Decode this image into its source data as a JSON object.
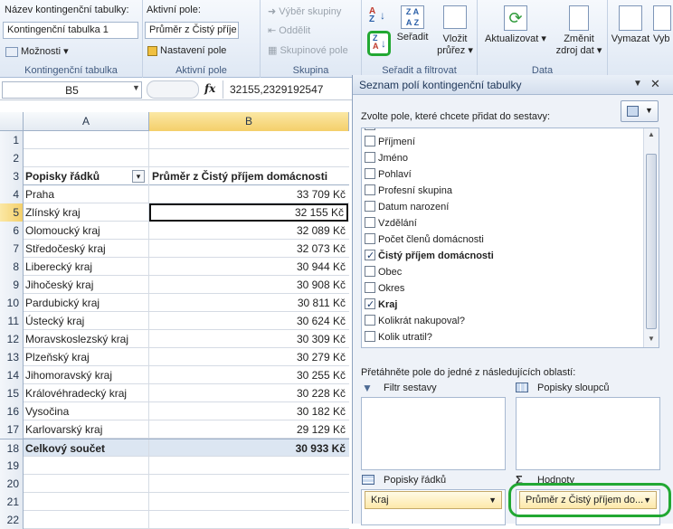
{
  "ribbon": {
    "pivot_name_label": "Název kontingenční tabulky:",
    "pivot_name_value": "Kontingenční tabulka 1",
    "options_label": "Možnosti",
    "group_pivot": "Kontingenční tabulka",
    "active_field_label": "Aktivní pole:",
    "active_field_value": "Průměr z Čistý příje",
    "field_settings_label": "Nastavení pole",
    "group_active_field": "Aktivní pole",
    "group_selection": "Výběr skupiny",
    "ungroup": "Oddělit",
    "group_field": "Skupinové pole",
    "group_group": "Skupina",
    "sort": "Seřadit",
    "group_sort_filter": "Seřadit a filtrovat",
    "insert_slicer_1": "Vložit",
    "insert_slicer_2": "průřez",
    "refresh": "Aktualizovat",
    "change_source_1": "Změnit",
    "change_source_2": "zdroj dat",
    "group_data": "Data",
    "clear": "Vymazat",
    "select": "Vyb"
  },
  "formula": {
    "cell_ref": "B5",
    "fx": "fx",
    "value": "32155,2329192547"
  },
  "grid": {
    "columns": [
      "A",
      "B"
    ],
    "rows": [
      {
        "n": "1",
        "a": "",
        "b": ""
      },
      {
        "n": "2",
        "a": "",
        "b": ""
      },
      {
        "n": "3",
        "a": "Popisky řádků",
        "b": "Průměr z Čistý příjem domácnosti"
      },
      {
        "n": "4",
        "a": "Praha",
        "b": "33 709 Kč"
      },
      {
        "n": "5",
        "a": "Zlínský kraj",
        "b": "32 155 Kč"
      },
      {
        "n": "6",
        "a": "Olomoucký kraj",
        "b": "32 089 Kč"
      },
      {
        "n": "7",
        "a": "Středočeský kraj",
        "b": "32 073 Kč"
      },
      {
        "n": "8",
        "a": "Liberecký kraj",
        "b": "30 944 Kč"
      },
      {
        "n": "9",
        "a": "Jihočeský kraj",
        "b": "30 908 Kč"
      },
      {
        "n": "10",
        "a": "Pardubický kraj",
        "b": "30 811 Kč"
      },
      {
        "n": "11",
        "a": "Ústecký kraj",
        "b": "30 624 Kč"
      },
      {
        "n": "12",
        "a": "Moravskoslezský kraj",
        "b": "30 309 Kč"
      },
      {
        "n": "13",
        "a": "Plzeňský kraj",
        "b": "30 279 Kč"
      },
      {
        "n": "14",
        "a": "Jihomoravský kraj",
        "b": "30 255 Kč"
      },
      {
        "n": "15",
        "a": "Královéhradecký kraj",
        "b": "30 228 Kč"
      },
      {
        "n": "16",
        "a": "Vysočina",
        "b": "30 182 Kč"
      },
      {
        "n": "17",
        "a": "Karlovarský kraj",
        "b": "29 129 Kč"
      },
      {
        "n": "18",
        "a": "Celkový součet",
        "b": "30 933 Kč"
      },
      {
        "n": "19",
        "a": "",
        "b": ""
      },
      {
        "n": "20",
        "a": "",
        "b": ""
      },
      {
        "n": "21",
        "a": "",
        "b": ""
      },
      {
        "n": "22",
        "a": "",
        "b": ""
      }
    ]
  },
  "pane": {
    "title": "Seznam polí kontingenční tabulky",
    "choose_label": "Zvolte pole, které chcete přidat do sestavy:",
    "fields": [
      {
        "label": "Příjmení",
        "checked": false,
        "bold": false
      },
      {
        "label": "Jméno",
        "checked": false,
        "bold": false
      },
      {
        "label": "Pohlaví",
        "checked": false,
        "bold": false
      },
      {
        "label": "Profesní skupina",
        "checked": false,
        "bold": false
      },
      {
        "label": "Datum narození",
        "checked": false,
        "bold": false
      },
      {
        "label": "Vzdělání",
        "checked": false,
        "bold": false
      },
      {
        "label": "Počet členů domácnosti",
        "checked": false,
        "bold": false
      },
      {
        "label": "Čistý příjem domácnosti",
        "checked": true,
        "bold": true
      },
      {
        "label": "Obec",
        "checked": false,
        "bold": false
      },
      {
        "label": "Okres",
        "checked": false,
        "bold": false
      },
      {
        "label": "Kraj",
        "checked": true,
        "bold": true
      },
      {
        "label": "Kolikrát nakupoval?",
        "checked": false,
        "bold": false
      },
      {
        "label": "Kolik utratil?",
        "checked": false,
        "bold": false
      }
    ],
    "drag_label": "Přetáhněte pole do jedné z následujících oblastí:",
    "filter_label": "Filtr sestavy",
    "columns_label": "Popisky sloupců",
    "rows_label": "Popisky řádků",
    "values_label": "Hodnoty",
    "row_chip": "Kraj",
    "value_chip": "Průměr z Čistý příjem do..."
  },
  "highlight_color": "#22a833"
}
